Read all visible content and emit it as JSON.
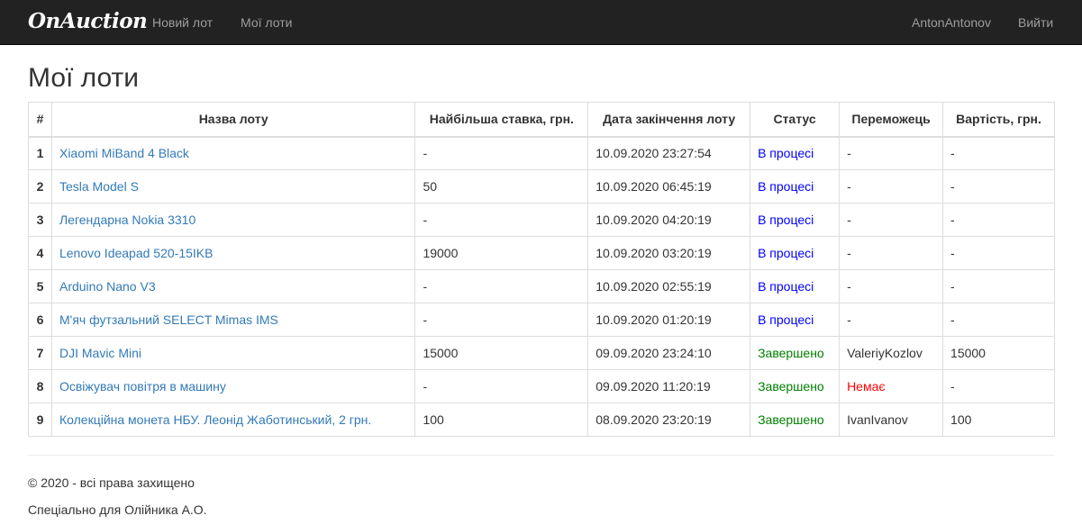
{
  "navbar": {
    "brand": "OnAuction",
    "new_lot": "Новий лот",
    "my_lots": "Мої лоти",
    "user": "AntonAntonov",
    "logout": "Вийти"
  },
  "page": {
    "title": "Мої лоти"
  },
  "table": {
    "headers": [
      "#",
      "Назва лоту",
      "Найбільша ставка, грн.",
      "Дата закінчення лоту",
      "Статус",
      "Переможець",
      "Вартість, грн."
    ],
    "rows": [
      {
        "num": "1",
        "name": "Xiaomi MiBand 4 Black",
        "bid": "-",
        "end": "10.09.2020 23:27:54",
        "status": "В процесі",
        "status_type": "active",
        "winner": "-",
        "price": "-"
      },
      {
        "num": "2",
        "name": "Tesla Model S",
        "bid": "50",
        "end": "10.09.2020 06:45:19",
        "status": "В процесі",
        "status_type": "active",
        "winner": "-",
        "price": "-"
      },
      {
        "num": "3",
        "name": "Легендарна Nokia 3310",
        "bid": "-",
        "end": "10.09.2020 04:20:19",
        "status": "В процесі",
        "status_type": "active",
        "winner": "-",
        "price": "-"
      },
      {
        "num": "4",
        "name": "Lenovo Ideapad 520-15IKB",
        "bid": "19000",
        "end": "10.09.2020 03:20:19",
        "status": "В процесі",
        "status_type": "active",
        "winner": "-",
        "price": "-"
      },
      {
        "num": "5",
        "name": "Arduino Nano V3",
        "bid": "-",
        "end": "10.09.2020 02:55:19",
        "status": "В процесі",
        "status_type": "active",
        "winner": "-",
        "price": "-"
      },
      {
        "num": "6",
        "name": "М'яч футзальний SELECT Mimas IMS",
        "bid": "-",
        "end": "10.09.2020 01:20:19",
        "status": "В процесі",
        "status_type": "active",
        "winner": "-",
        "price": "-"
      },
      {
        "num": "7",
        "name": "DJI Mavic Mini",
        "bid": "15000",
        "end": "09.09.2020 23:24:10",
        "status": "Завершено",
        "status_type": "done",
        "winner": "ValeriyKozlov",
        "price": "15000"
      },
      {
        "num": "8",
        "name": "Освіжувач повітря в машину",
        "bid": "-",
        "end": "09.09.2020 11:20:19",
        "status": "Завершено",
        "status_type": "done",
        "winner": "Немає",
        "winner_none": true,
        "price": "-"
      },
      {
        "num": "9",
        "name": "Колекційна монета НБУ. Леонід Жаботинський, 2 грн.",
        "bid": "100",
        "end": "08.09.2020 23:20:19",
        "status": "Завершено",
        "status_type": "done",
        "winner": "IvanIvanov",
        "price": "100"
      }
    ]
  },
  "footer": {
    "copyright": "© 2020 - всі права захищено",
    "credit": "Спеціально для Олійника А.О."
  },
  "colors": {
    "navbar_bg": "#222222",
    "link": "#337ab7",
    "status_active": "#0000ff",
    "status_done": "#008000",
    "no_winner": "#ff0000"
  }
}
